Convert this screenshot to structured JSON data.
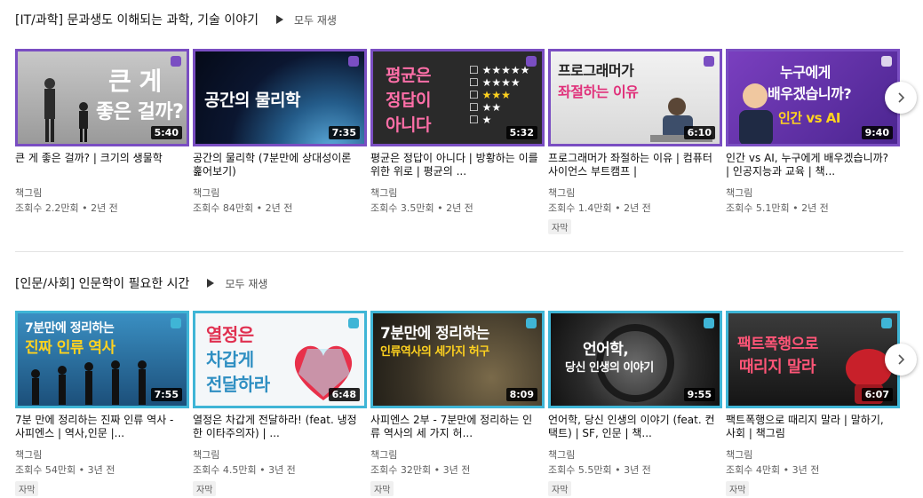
{
  "shelves": [
    {
      "title": "[IT/과학] 문과생도 이해되는 과학, 기술 이야기",
      "play_all": "모두 재생",
      "videos": [
        {
          "thumb_text": [
            "큰 게",
            "좋은 걸까?"
          ],
          "duration": "5:40",
          "title": "큰 게 좋은 걸까? | 크기의 생물학",
          "channel": "책그림",
          "meta": "조회수 2.2만회 • 2년 전",
          "badge": ""
        },
        {
          "thumb_text": [
            "공간의 물리학"
          ],
          "duration": "7:35",
          "title": "공간의 물리학 (7분만에 상대성이론 훑어보기)",
          "channel": "책그림",
          "meta": "조회수 84만회 • 2년 전",
          "badge": ""
        },
        {
          "thumb_text": [
            "평균은",
            "정답이",
            "아니다"
          ],
          "duration": "5:32",
          "title": "평균은 정답이 아니다 | 방황하는 이를 위한 위로 | 평균의 ...",
          "channel": "책그림",
          "meta": "조회수 3.5만회 • 2년 전",
          "badge": ""
        },
        {
          "thumb_text": [
            "프로그래머가",
            "좌절하는 이유"
          ],
          "duration": "6:10",
          "title": "프로그래머가 좌절하는 이유 | 컴퓨터 사이언스 부트캠프 |",
          "channel": "책그림",
          "meta": "조회수 1.4만회 • 2년 전",
          "badge": "자막"
        },
        {
          "thumb_text": [
            "누구에게",
            "배우겠습니까?",
            "인간 vs AI"
          ],
          "duration": "9:40",
          "title": "인간 vs AI, 누구에게 배우겠습니까? | 인공지능과 교육 | 책...",
          "channel": "책그림",
          "meta": "조회수 5.1만회 • 2년 전",
          "badge": ""
        }
      ]
    },
    {
      "title": "[인문/사회] 인문학이 필요한 시간",
      "play_all": "모두 재생",
      "videos": [
        {
          "thumb_text": [
            "7분만에 정리하는",
            "진짜 인류 역사"
          ],
          "duration": "7:55",
          "title": "7분 만에 정리하는 진짜 인류 역사 - 사피엔스 | 역사,인문 |...",
          "channel": "책그림",
          "meta": "조회수 54만회 • 3년 전",
          "badge": "자막"
        },
        {
          "thumb_text": [
            "열정은",
            "차갑게",
            "전달하라"
          ],
          "duration": "6:48",
          "title": "열정은 차갑게 전달하라! (feat. 냉정한 이타주의자) | ...",
          "channel": "책그림",
          "meta": "조회수 4.5만회 • 3년 전",
          "badge": "자막"
        },
        {
          "thumb_text": [
            "7분만에 정리하는",
            "인류역사의 세가지 허구"
          ],
          "duration": "8:09",
          "title": "사피엔스 2부 - 7분만에 정리하는 인류 역사의 세 가지 허...",
          "channel": "책그림",
          "meta": "조회수 32만회 • 3년 전",
          "badge": "자막"
        },
        {
          "thumb_text": [
            "언어학,",
            "당신 인생의 이야기"
          ],
          "duration": "9:55",
          "title": "언어학, 당신 인생의 이야기 (feat. 컨택트) | SF, 인문 | 책...",
          "channel": "책그림",
          "meta": "조회수 5.5만회 • 3년 전",
          "badge": "자막"
        },
        {
          "thumb_text": [
            "팩트폭행으로",
            "때리지 말라"
          ],
          "duration": "6:07",
          "title": "팩트폭행으로 때리지 말라 | 말하기, 사회 |  책그림",
          "channel": "책그림",
          "meta": "조회수 4만회 • 3년 전",
          "badge": "자막"
        }
      ]
    }
  ],
  "colors": {
    "border_it": "#7a4ec2",
    "border_hum": "#3fb5d6",
    "badge_bg": "#f0f0f0",
    "meta": "#606060"
  }
}
